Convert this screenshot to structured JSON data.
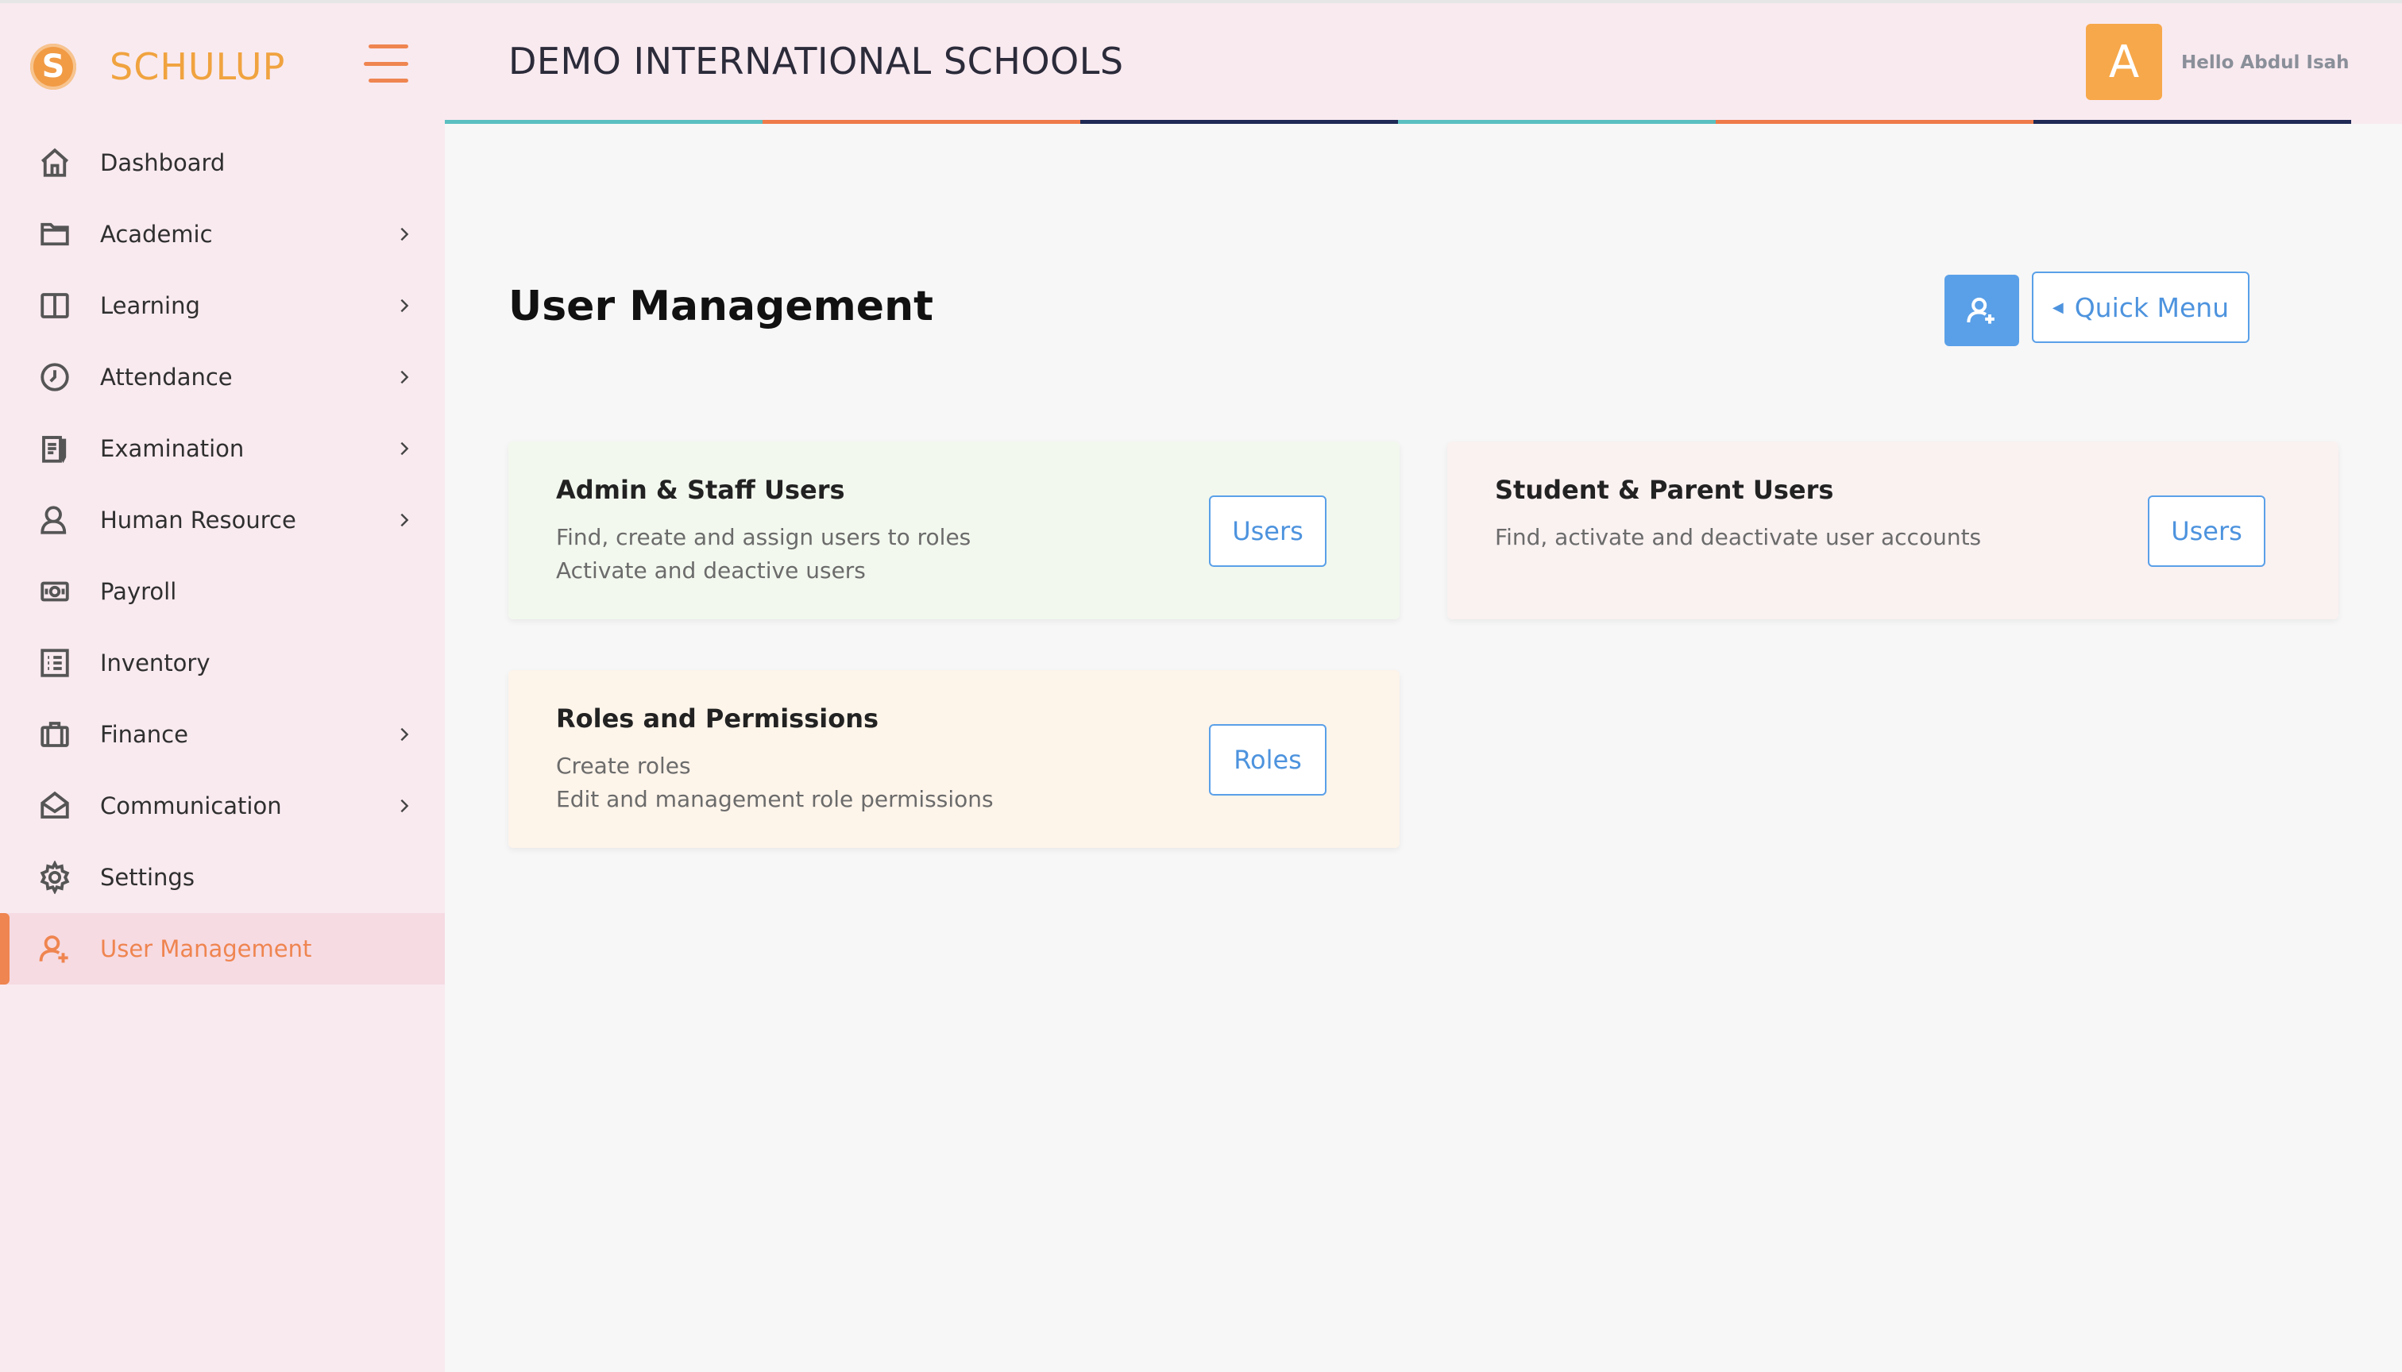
{
  "app": {
    "brand_letter": "S",
    "brand_name": "SCHULUP"
  },
  "header": {
    "school_name": "DEMO INTERNATIONAL SCHOOLS",
    "avatar_letter": "A",
    "greeting": "Hello Abdul Isah",
    "strip_colors": [
      "#5bbfc0",
      "#ef7a4a",
      "#1f2a55",
      "#5bbfc0",
      "#ef7a4a",
      "#1f2a55"
    ]
  },
  "sidebar": {
    "items": [
      {
        "label": "Dashboard",
        "icon": "home-icon",
        "has_children": false
      },
      {
        "label": "Academic",
        "icon": "folder-icon",
        "has_children": true
      },
      {
        "label": "Learning",
        "icon": "book-icon",
        "has_children": true
      },
      {
        "label": "Attendance",
        "icon": "clock-icon",
        "has_children": true
      },
      {
        "label": "Examination",
        "icon": "exam-icon",
        "has_children": true
      },
      {
        "label": "Human Resource",
        "icon": "person-icon",
        "has_children": true
      },
      {
        "label": "Payroll",
        "icon": "money-icon",
        "has_children": false
      },
      {
        "label": "Inventory",
        "icon": "list-icon",
        "has_children": false
      },
      {
        "label": "Finance",
        "icon": "briefcase-icon",
        "has_children": true
      },
      {
        "label": "Communication",
        "icon": "mail-icon",
        "has_children": true
      },
      {
        "label": "Settings",
        "icon": "gear-icon",
        "has_children": false
      },
      {
        "label": "User Management",
        "icon": "user-plus-icon",
        "has_children": false,
        "active": true
      }
    ]
  },
  "main": {
    "title": "User Management",
    "quick_menu_label": "Quick Menu",
    "cards": [
      {
        "title": "Admin & Staff Users",
        "lines": [
          "Find, create and assign users to roles",
          "Activate and deactive users"
        ],
        "button": "Users"
      },
      {
        "title": "Student & Parent Users",
        "lines": [
          "Find, activate and deactivate user accounts"
        ],
        "button": "Users"
      },
      {
        "title": "Roles and Permissions",
        "lines": [
          "Create roles",
          "Edit and management role permissions"
        ],
        "button": "Roles"
      }
    ]
  },
  "colors": {
    "accent": "#ef8550",
    "primary": "#5aa0e8",
    "brand": "#f0a33f"
  }
}
